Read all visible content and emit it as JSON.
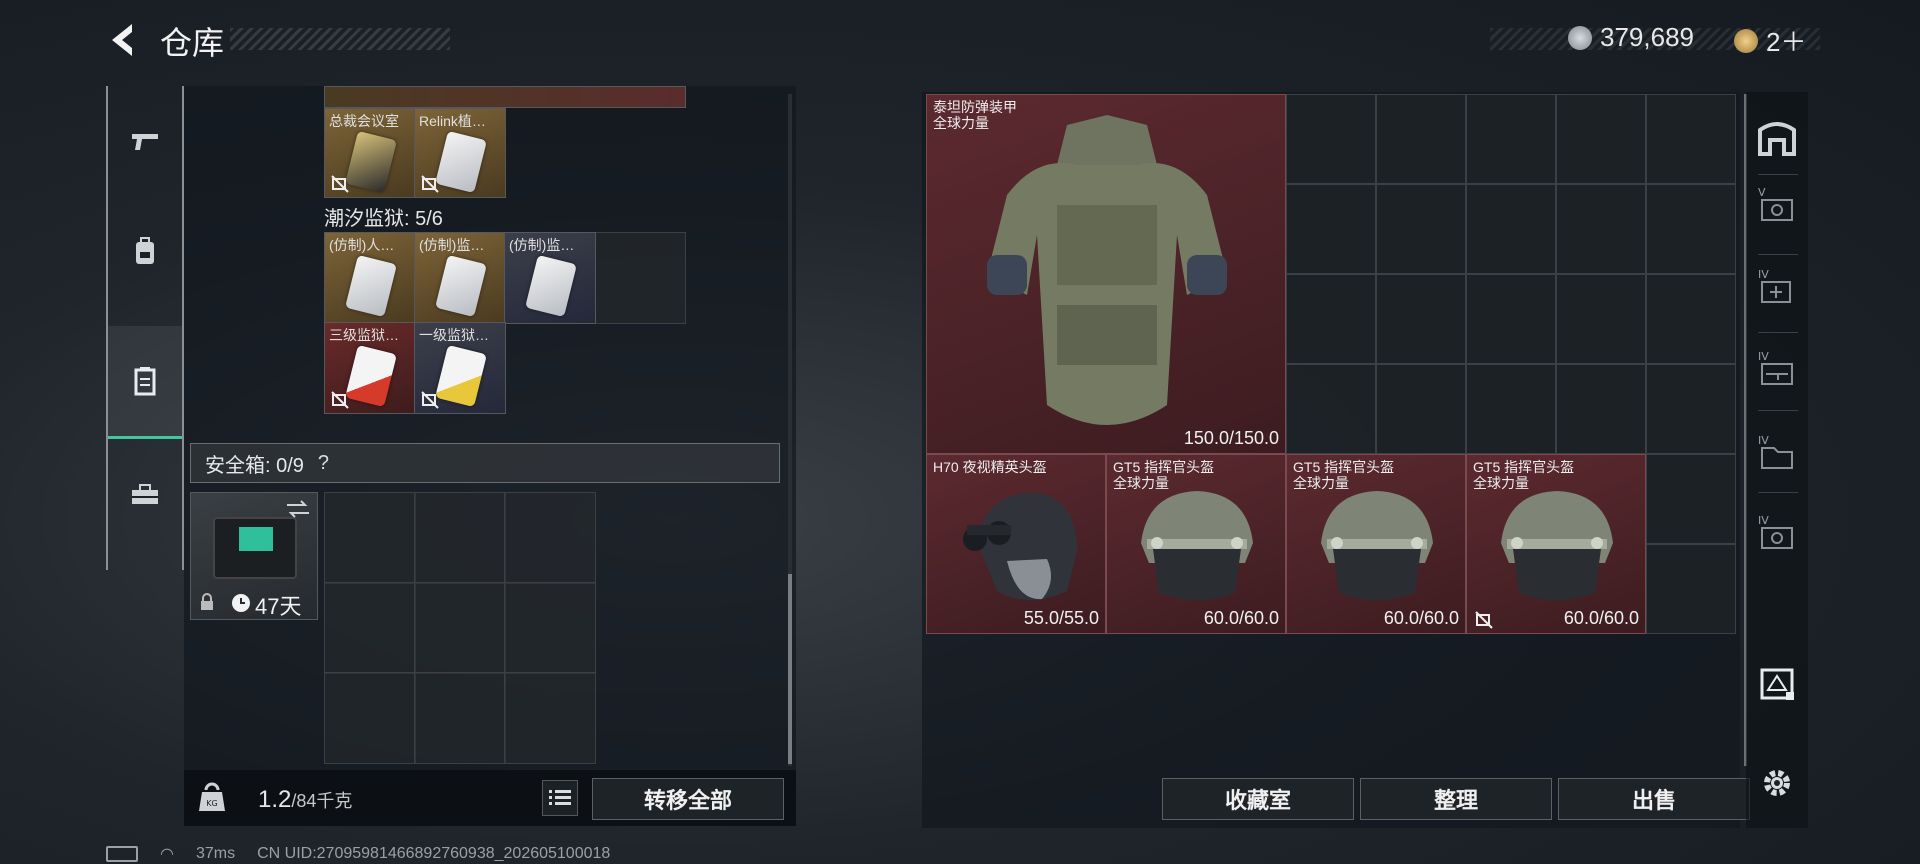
{
  "header": {
    "title": "仓库",
    "currency1": "379,689",
    "currency2": "2＋"
  },
  "left_panel": {
    "top_items": [
      {
        "label": "总裁会议室",
        "color": "brown"
      },
      {
        "label": "Relink植…",
        "color": "brown"
      }
    ],
    "group_label": "潮汐监狱: 5/6",
    "group_items": [
      {
        "label": "(仿制)人…",
        "color": "brown"
      },
      {
        "label": "(仿制)监…",
        "color": "brown"
      },
      {
        "label": "(仿制)监…",
        "color": "dark"
      },
      {
        "label": "三级监狱…",
        "color": "red"
      },
      {
        "label": "一级监狱…",
        "color": "dark"
      }
    ],
    "safebox_label": "安全箱: 0/9",
    "safebox_help": "?",
    "safebox_item_timer": "47天",
    "weight_value": "1.2",
    "weight_max": "/84千克",
    "transfer_all": "转移全部"
  },
  "right_panel": {
    "items": [
      {
        "name": "泰坦防弹装甲",
        "sub": "全球力量",
        "durability": "150.0/150.0",
        "kind": "armor"
      },
      {
        "name": "H70 夜视精英头盔",
        "sub": "",
        "durability": "55.0/55.0",
        "kind": "helmet-nv"
      },
      {
        "name": "GT5 指挥官头盔",
        "sub": "全球力量",
        "durability": "60.0/60.0",
        "kind": "helmet"
      },
      {
        "name": "GT5 指挥官头盔",
        "sub": "全球力量",
        "durability": "60.0/60.0",
        "kind": "helmet"
      },
      {
        "name": "GT5 指挥官头盔",
        "sub": "全球力量",
        "durability": "60.0/60.0",
        "kind": "helmet",
        "locked_icon": true
      }
    ],
    "buttons": {
      "collection": "收藏室",
      "organize": "整理",
      "sell": "出售"
    }
  },
  "right_nav_labels": [
    "V",
    "IV",
    "IV",
    "IV",
    "IV"
  ],
  "status": {
    "ping": "37ms",
    "uid": "CN UID:27095981466892760938_202605100018"
  },
  "colors": {
    "accent_green": "#41c89a",
    "item_red": "#5c2a30"
  }
}
